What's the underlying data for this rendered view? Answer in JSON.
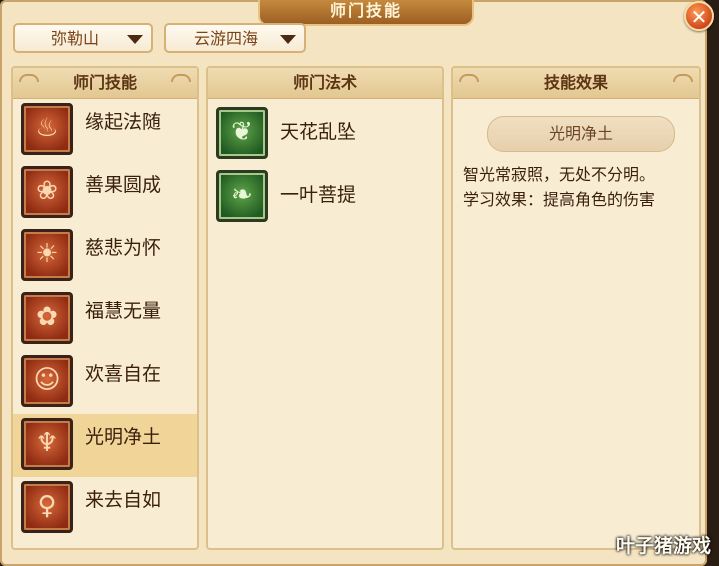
{
  "window": {
    "title": "师门技能",
    "close_icon": "close-icon"
  },
  "dropdowns": [
    {
      "value": "弥勒山"
    },
    {
      "value": "云游四海"
    }
  ],
  "panels": {
    "skills": {
      "header": "师门技能",
      "items": [
        {
          "label": "缘起法随",
          "icon": "lotus-figure-icon",
          "glyph": "♨"
        },
        {
          "label": "善果圆成",
          "icon": "fruit-icon",
          "glyph": "❀"
        },
        {
          "label": "慈悲为怀",
          "icon": "radiant-stupa-icon",
          "glyph": "☀"
        },
        {
          "label": "福慧无量",
          "icon": "flower-icon",
          "glyph": "✿"
        },
        {
          "label": "欢喜自在",
          "icon": "laughing-monk-icon",
          "glyph": "☺"
        },
        {
          "label": "光明净土",
          "icon": "flame-icon",
          "glyph": "♆",
          "selected": true
        },
        {
          "label": "来去自如",
          "icon": "meditating-figure-icon",
          "glyph": "♀"
        }
      ]
    },
    "spells": {
      "header": "师门法术",
      "items": [
        {
          "label": "天花乱坠",
          "icon": "petals-icon",
          "glyph": "❦"
        },
        {
          "label": "一叶菩提",
          "icon": "leaf-icon",
          "glyph": "❧"
        }
      ]
    },
    "effect": {
      "header": "技能效果",
      "skill_name": "光明净土",
      "line1": "智光常寂照，无处不分明。",
      "line2": "学习效果：提高角色的伤害"
    }
  },
  "watermark": "叶子猪游戏",
  "colors": {
    "accent": "#9c5f23",
    "panel_bg": "#f8ecd2",
    "selected_row": "#f1d497",
    "skill_icon": "#b8451f",
    "spell_icon": "#3f7f35"
  }
}
